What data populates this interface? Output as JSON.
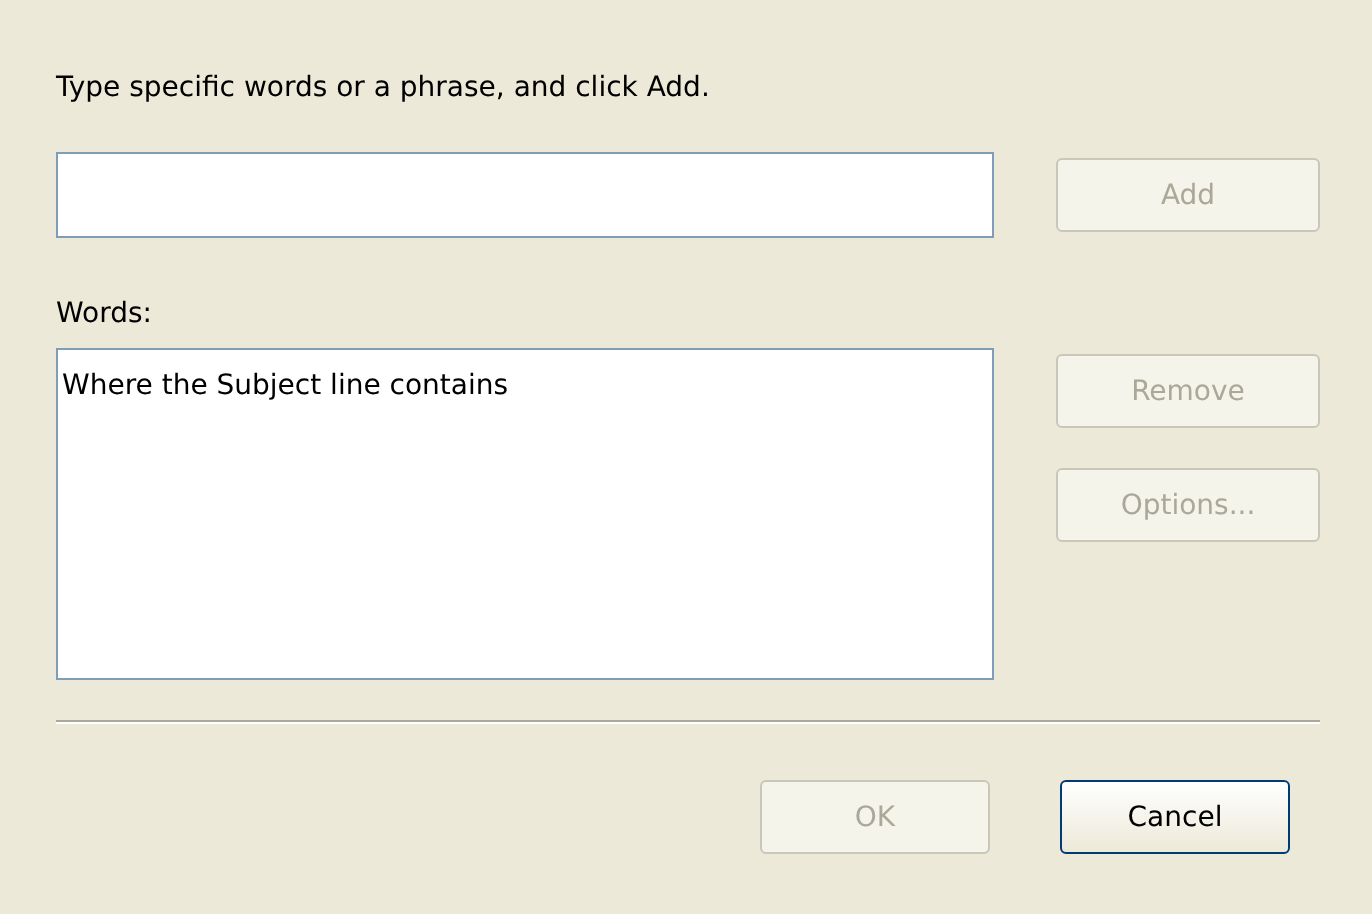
{
  "instruction": "Type specific words or a phrase, and click Add.",
  "add_button": {
    "label": "Add",
    "disabled": true
  },
  "words": {
    "label": "Words:",
    "items": [
      {
        "text": "Where the Subject line contains",
        "selected": false
      }
    ]
  },
  "side_buttons": [
    {
      "label": "Remove",
      "disabled": true
    },
    {
      "label": "Options...",
      "disabled": true
    }
  ],
  "footer_buttons": [
    {
      "label": "OK",
      "disabled": true
    },
    {
      "label": "Cancel",
      "disabled": false
    }
  ]
}
